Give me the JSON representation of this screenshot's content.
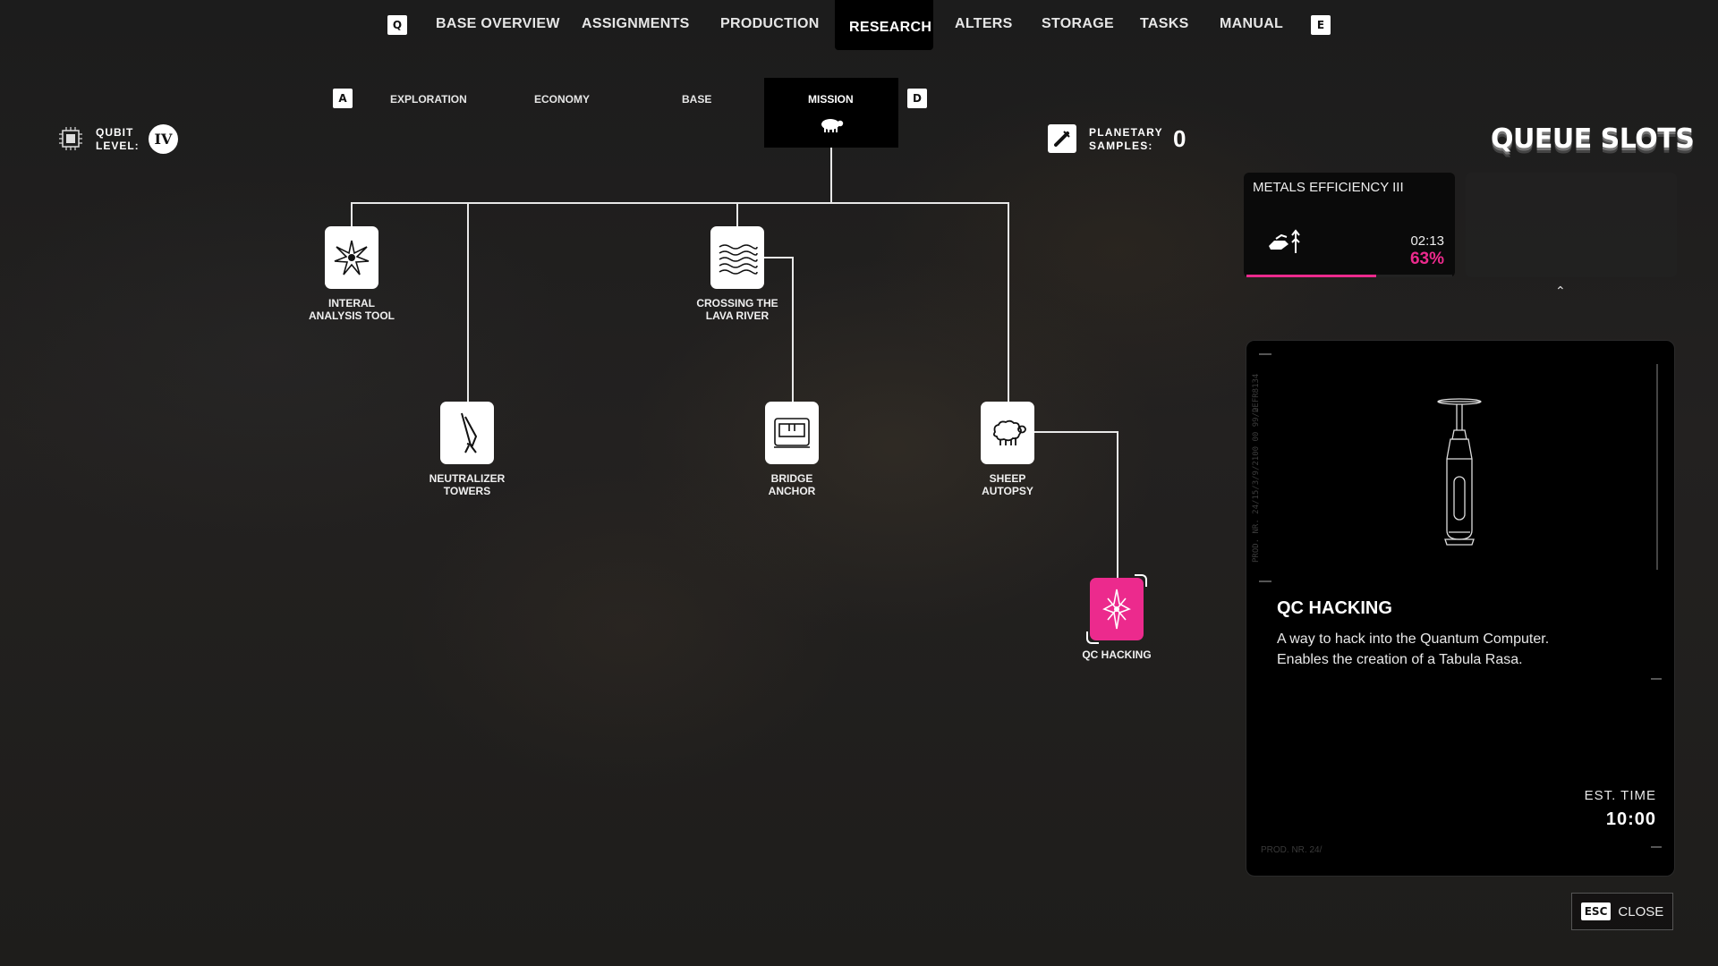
{
  "top_nav": {
    "left_key": "Q",
    "right_key": "E",
    "items": [
      {
        "label": "BASE OVERVIEW"
      },
      {
        "label": "ASSIGNMENTS"
      },
      {
        "label": "PRODUCTION"
      },
      {
        "label": "RESEARCH"
      },
      {
        "label": "ALTERS"
      },
      {
        "label": "STORAGE"
      },
      {
        "label": "TASKS"
      },
      {
        "label": "MANUAL"
      }
    ],
    "active": "RESEARCH"
  },
  "sub_tabs": {
    "left_key": "A",
    "right_key": "D",
    "items": [
      {
        "label": "EXPLORATION"
      },
      {
        "label": "ECONOMY"
      },
      {
        "label": "BASE"
      },
      {
        "label": "MISSION"
      }
    ],
    "active": "MISSION"
  },
  "qubit": {
    "label_line1": "QUBIT",
    "label_line2": "LEVEL:",
    "level": "IV"
  },
  "planetary_samples": {
    "label_line1": "PLANETARY",
    "label_line2": "SAMPLES:",
    "value": "0"
  },
  "queue": {
    "title": "QUEUE SLOTS",
    "slots": [
      {
        "name": "METALS EFFICIENCY III",
        "time": "02:13",
        "percent": "63%",
        "progress": 0.63
      },
      {
        "name": "",
        "time": "",
        "percent": "",
        "progress": 0
      }
    ]
  },
  "tree": {
    "nodes": [
      {
        "label": "INTERAL\nANALYSIS TOOL",
        "icon": "starburst-icon"
      },
      {
        "label": "CROSSING THE\nLAVA RIVER",
        "icon": "waves-icon"
      },
      {
        "label": "NEUTRALIZER\nTOWERS",
        "icon": "antenna-icon"
      },
      {
        "label": "BRIDGE\nANCHOR",
        "icon": "machine-icon"
      },
      {
        "label": "SHEEP\nAUTOPSY",
        "icon": "sheep-icon"
      },
      {
        "label": "QC HACKING",
        "icon": "compass-star-icon"
      }
    ],
    "selected": "QC HACKING"
  },
  "detail": {
    "title": "QC HACKING",
    "description_line1": "A way to hack into the Quantum Computer.",
    "description_line2": "Enables the creation of a Tabula Rasa.",
    "est_label": "EST. TIME",
    "est_value": "10:00",
    "side_text": "PROD. NR. 24/15/3/9/2100 00 99/2",
    "side_code": "DEFR8134",
    "footer_text": "PROD. NR. 24/"
  },
  "close": {
    "key": "ESC",
    "label": "CLOSE"
  },
  "colors": {
    "accent": "#ec2a8d",
    "bg": "#1e1e1e",
    "panel": "#000000"
  }
}
